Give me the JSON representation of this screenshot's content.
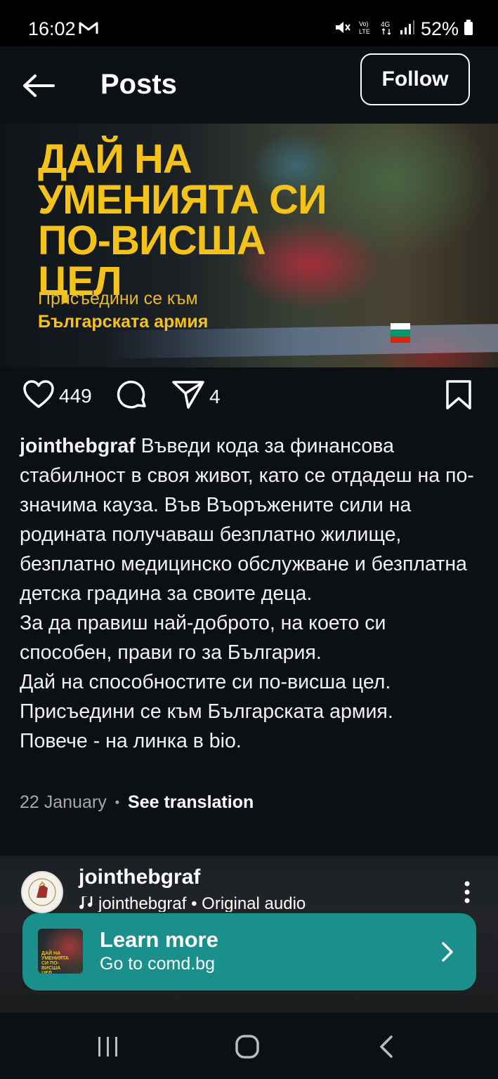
{
  "status_bar": {
    "time": "16:02",
    "battery": "52%",
    "icons": [
      "gmail-icon",
      "mute-icon",
      "volte-icon",
      "4g-icon",
      "signal-icon",
      "battery-icon"
    ]
  },
  "header": {
    "title": "Posts",
    "follow_label": "Follow"
  },
  "banner": {
    "headline": "ДАЙ НА УМЕНИЯТА СИ ПО-ВИСША ЦЕЛ",
    "subtitle_line1": "Присъедини се към",
    "subtitle_line2": "Българската армия"
  },
  "actions": {
    "likes": "449",
    "shares": "4"
  },
  "caption": {
    "username": "jointhebgraf",
    "first_paragraph": "Въведи кода за финансова стабилност в своя живот, като се отдадеш на по-значима кауза. Във Въоръжените сили на родината получаваш безплатно жилище, безплатно медицинско обслужване и безплатна детска градина за своите деца.",
    "lines": [
      "За да правиш най-доброто, на което си способен, прави го за България.",
      "Дай на способностите си по-висша цел.",
      "Присъедини се към Българската армия.",
      "Повече - на линка в bio."
    ]
  },
  "meta": {
    "date": "22 January",
    "see_translation": "See translation"
  },
  "next_post": {
    "username": "jointhebgraf",
    "audio": "jointhebgraf • Original audio"
  },
  "cta": {
    "title": "Learn more",
    "subtitle": "Go to comd.bg",
    "thumb_text": "ДАЙ НА УМЕНИЯТА СИ ПО-ВИСША ЦЕЛ"
  },
  "colors": {
    "accent_yellow": "#f5c21a",
    "cta_teal": "#1a8f8c",
    "background": "#0c0f14"
  }
}
